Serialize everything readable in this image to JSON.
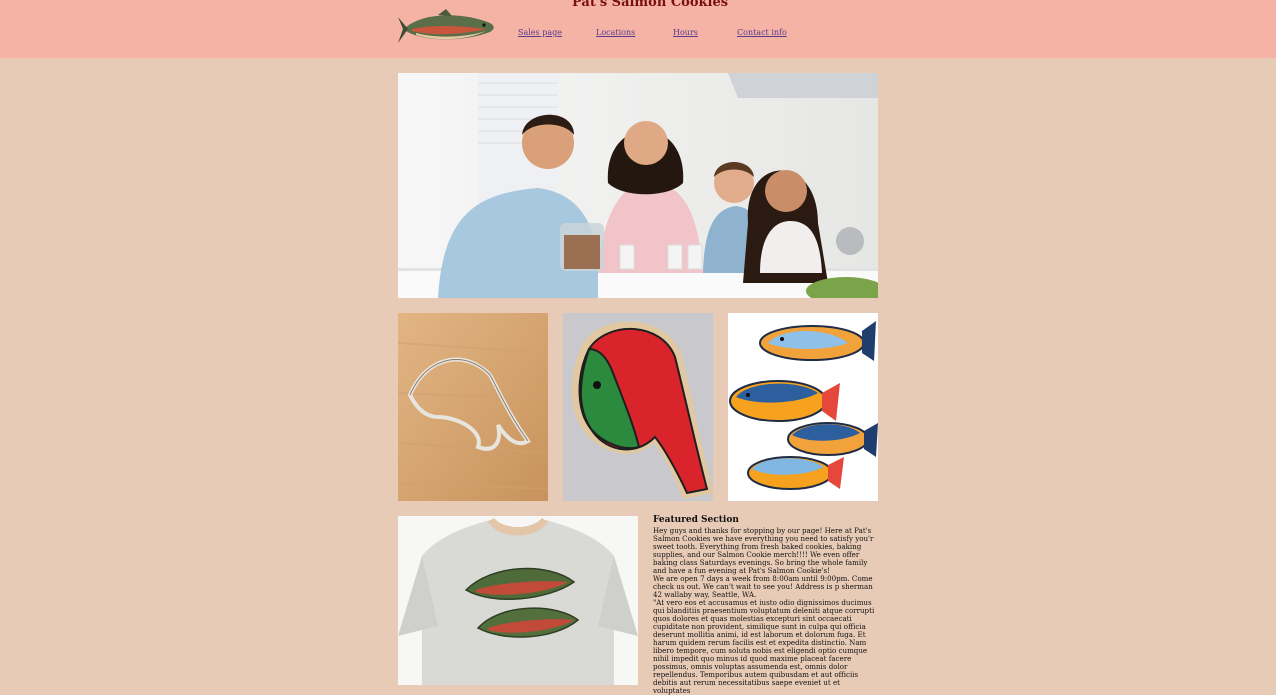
{
  "header": {
    "title": "Pat's Salmon Cookies",
    "logo_icon": "salmon-fish-icon",
    "nav": [
      {
        "label": "Sales page"
      },
      {
        "label": "Locations"
      },
      {
        "label": "Hours"
      },
      {
        "label": "Contact info"
      }
    ]
  },
  "images": {
    "hero": "family-kitchen-photo",
    "thumbs": [
      "salmon-cookie-cutter-photo",
      "iced-salmon-cookie-photo",
      "three-fish-cookies-photo"
    ],
    "shirt": "salmon-tshirt-photo"
  },
  "featured": {
    "title": "Featured Section",
    "intro": "Hey guys and thanks for stopping by our page! Here at Pat's Salmon Cookies we have everything you need to satisfy you'r sweet tooth. Everything from fresh baked cookies, baking supplies, and our Salmon Cookie merch!!!! We even offer baking class Saturdays evenings. So bring the whole family and have a fun evening at Pat's Salmon Cookie's!",
    "hours": "We are open 7 days a week from 8:00am until 9:00pm. Come check us out. We can't wait to see you! Address is p sherman 42 wallaby way, Seattle, WA.",
    "quote": "\"At vero eos et accusamus et iusto odio dignissimos ducimus qui blanditiis praesentium voluptatum deleniti atque corrupti quos dolores et quas molestias excepturi sint occaecati cupiditate non provident, similique sunt in culpa qui officia deserunt mollitia animi, id est laborum et dolorum fuga. Et harum quidem rerum facilis est et expedita distinctio. Nam libero tempore, cum soluta nobis est eligendi optio cumque nihil impedit quo minus id quod maxime placeat facere possimus, omnis voluptas assumenda est, omnis dolor repellendus. Temporibus autem quibusdam et aut officiis debitis aut rerum necessitatibus saepe eveniet ut et voluptates"
  },
  "colors": {
    "background": "#e8cbb6",
    "header": "#f5b3a6",
    "title": "#7a1010",
    "link": "#5a3c8a"
  }
}
